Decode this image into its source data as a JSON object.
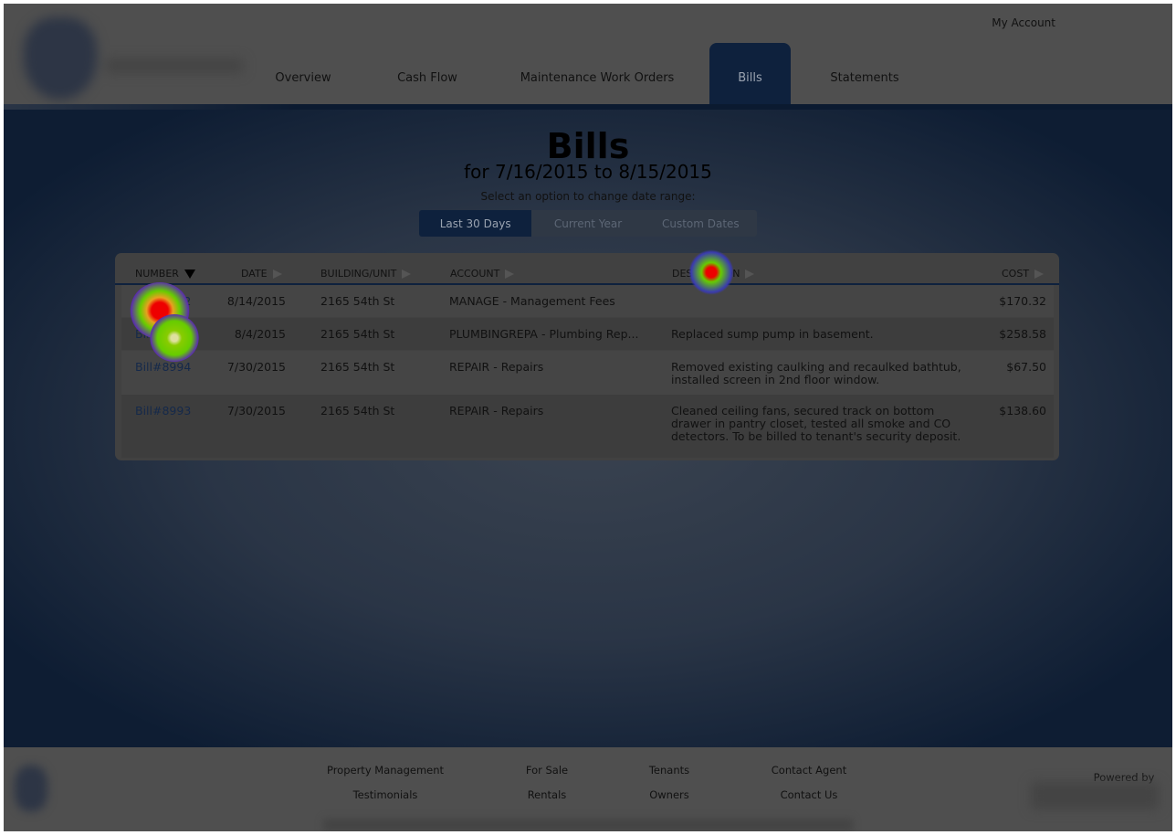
{
  "header": {
    "account_link": "My Account",
    "tabs": [
      {
        "label": "Overview",
        "active": false
      },
      {
        "label": "Cash Flow",
        "active": false
      },
      {
        "label": "Maintenance Work Orders",
        "active": false
      },
      {
        "label": "Bills",
        "active": true
      },
      {
        "label": "Statements",
        "active": false
      }
    ]
  },
  "page": {
    "title": "Bills",
    "subtitle": "for 7/16/2015 to 8/15/2015",
    "prompt": "Select an option to change date range:",
    "ranges": [
      {
        "label": "Last 30 Days",
        "selected": true
      },
      {
        "label": "Current Year",
        "selected": false
      },
      {
        "label": "Custom Dates",
        "selected": false
      }
    ]
  },
  "table": {
    "columns": [
      "NUMBER",
      "DATE",
      "BUILDING/UNIT",
      "ACCOUNT",
      "DESCRIPTION",
      "COST"
    ],
    "sort_column": "NUMBER",
    "sort_direction": "descending",
    "rows": [
      {
        "number": "Bill#9052",
        "date": "8/14/2015",
        "building": "2165 54th St",
        "account": "MANAGE - Management Fees",
        "description": "",
        "cost": "$170.32"
      },
      {
        "number": "Bill#9005",
        "date": "8/4/2015",
        "building": "2165 54th St",
        "account": "PLUMBINGREPA - Plumbing Rep...",
        "description": "Replaced sump pump in basement.",
        "cost": "$258.58"
      },
      {
        "number": "Bill#8994",
        "date": "7/30/2015",
        "building": "2165 54th St",
        "account": "REPAIR - Repairs",
        "description": "Removed existing caulking and recaulked bathtub, installed screen in 2nd floor window.",
        "cost": "$67.50"
      },
      {
        "number": "Bill#8993",
        "date": "7/30/2015",
        "building": "2165 54th St",
        "account": "REPAIR - Repairs",
        "description": "Cleaned ceiling fans, secured track on bottom drawer in pantry closet, tested all smoke and CO detectors. To be billed to tenant's security deposit.",
        "cost": "$138.60"
      }
    ]
  },
  "footer": {
    "links": [
      [
        "Property Management",
        "Testimonials"
      ],
      [
        "For Sale",
        "Rentals"
      ],
      [
        "Tenants",
        "Owners"
      ],
      [
        "Contact Agent",
        "Contact Us"
      ]
    ],
    "powered_by": "Powered by"
  },
  "colors": {
    "nav_active": "#0e213d",
    "link": "#15294a",
    "heatmap_hot": "#ff0000",
    "heatmap_warm": "#00ff00",
    "heatmap_cool": "#3a20c0"
  }
}
